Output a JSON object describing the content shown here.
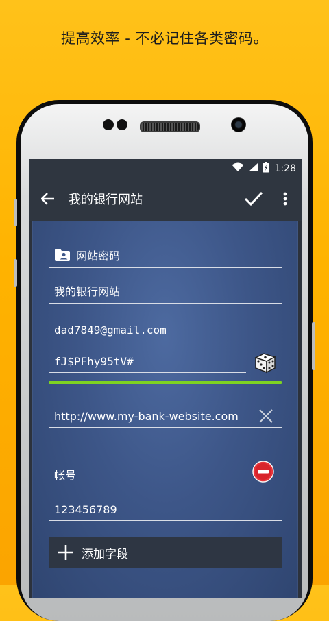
{
  "headline": "提高效率 - 不必记住各类密码。",
  "status_bar": {
    "time": "1:28",
    "icons": [
      "wifi-icon",
      "signal-icon",
      "battery-icon"
    ]
  },
  "toolbar": {
    "title": "我的银行网站",
    "back_icon": "arrow-left-icon",
    "save_icon": "check-icon",
    "more_icon": "more-vert-icon"
  },
  "form": {
    "category": "网站密码",
    "category_icon": "folder-account-icon",
    "title_value": "我的银行网站",
    "username_value": "dad7849@gmail.com",
    "password_value": "fJ$PFhy95tV#",
    "password_generator_icon": "dice-icon",
    "url_value": "http://www.my-bank-website.com",
    "url_clear_icon": "close-icon",
    "custom_field_label": "帐号",
    "custom_field_remove_icon": "remove-circle-icon",
    "custom_field_value": "123456789",
    "add_field_label": "添加字段",
    "add_field_icon": "plus-icon"
  },
  "colors": {
    "background": "#ffb300",
    "toolbar": "#2f3640",
    "content": "#3d5688",
    "strength_bar": "#7ed321",
    "remove_button": "#e8343a"
  }
}
